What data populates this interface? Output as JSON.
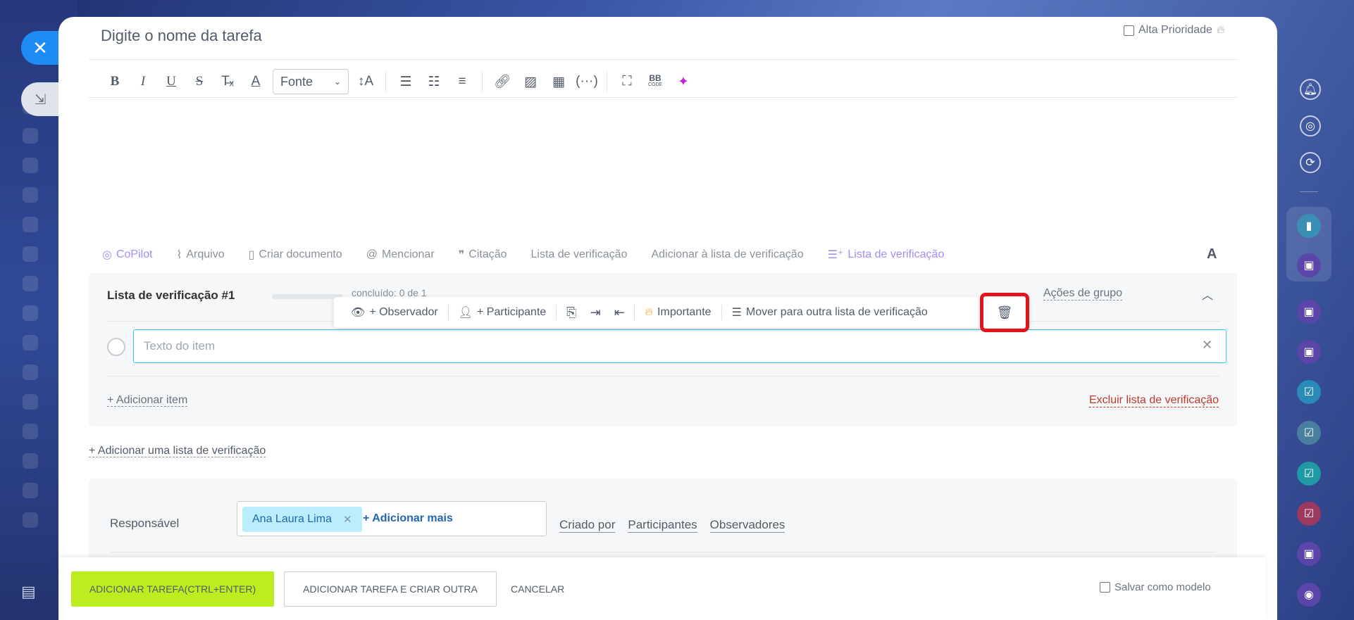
{
  "task": {
    "title_placeholder": "Digite o nome da tarefa",
    "high_priority_label": "Alta Prioridade"
  },
  "editor": {
    "font_select": "Fonte",
    "bbcode_top": "BB",
    "bbcode_bottom": "CODE"
  },
  "actions": {
    "copilot": "CoPilot",
    "file": "Arquivo",
    "create_doc": "Criar documento",
    "mention": "Mencionar",
    "quote": "Citação",
    "checklist": "Lista de verificação",
    "add_to_checklist": "Adicionar à lista de verificação",
    "checklist_active": "Lista de verificação",
    "font_toggle": "A"
  },
  "checklist": {
    "title": "Lista de verificação #1",
    "done_text": "concluído: 0 de 1",
    "progress": 0,
    "group_actions": "Ações de grupo",
    "item_placeholder": "Texto do item",
    "add_item": "+ Adicionar item",
    "delete_list": "Excluir lista de verificação",
    "add_list": "+ Adicionar uma lista de verificação"
  },
  "item_toolbar": {
    "observer": "+ Observador",
    "participant": "+ Participante",
    "important": "Importante",
    "move": "Mover para outra lista de verificação"
  },
  "people": {
    "responsible_label": "Responsável",
    "responsible_chip": "Ana Laura Lima",
    "add_more": "+ Adicionar mais",
    "created_by": "Criado por",
    "participants": "Participantes",
    "observers": "Observadores"
  },
  "footer": {
    "add_task": "ADICIONAR TAREFA(CTRL+ENTER)",
    "add_and_create": "ADICIONAR TAREFA E CRIAR OUTRA",
    "cancel": "CANCELAR",
    "save_template": "Salvar como modelo"
  },
  "colors": {
    "accent_lime": "#bbed21",
    "highlight_red": "#e3131b",
    "link_blue": "#2067b0",
    "chip_bg": "#bcedfc"
  }
}
